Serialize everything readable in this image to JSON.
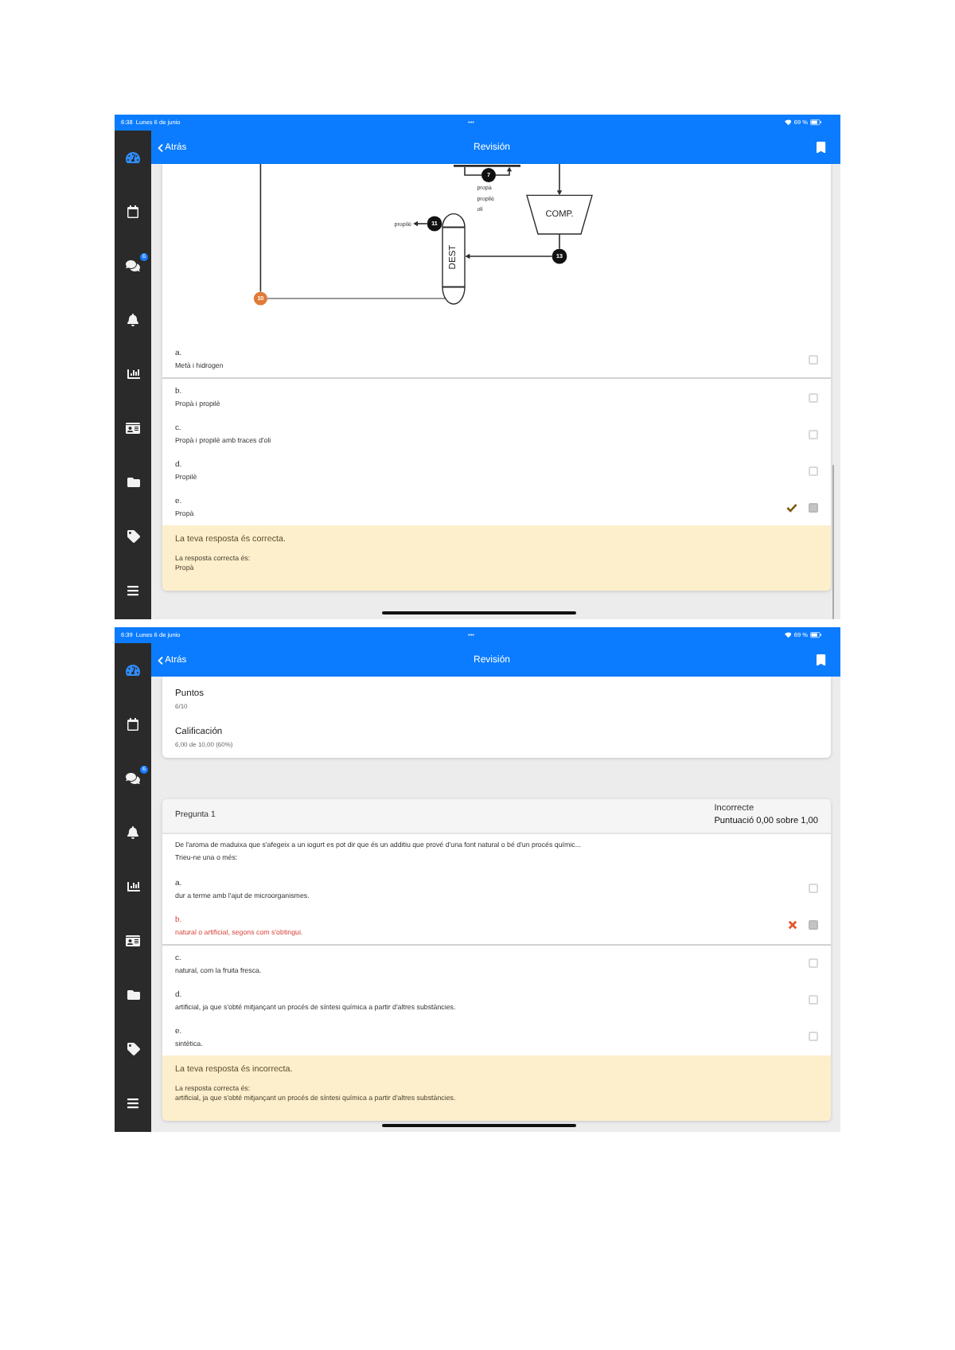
{
  "screens": [
    {
      "status_bar": {
        "time": "6:38",
        "date": "Lunes 6 de junio",
        "dots": "•••",
        "battery": "69 %"
      },
      "nav": {
        "back": "Atrás",
        "title": "Revisión"
      },
      "sidebar": [
        {
          "kind": "dashboard",
          "selected": true
        },
        {
          "kind": "calendar",
          "selected": false
        },
        {
          "kind": "messages",
          "selected": false,
          "badge": "6"
        },
        {
          "kind": "notifications",
          "selected": false
        },
        {
          "kind": "grades",
          "selected": false
        },
        {
          "kind": "badges",
          "selected": false
        },
        {
          "kind": "files",
          "selected": false
        },
        {
          "kind": "tags",
          "selected": false
        },
        {
          "kind": "menu",
          "selected": false
        }
      ],
      "cards": [
        {
          "kind": "question",
          "diagram": {
            "units": [
              {
                "kind": "compressor",
                "label": "COMP."
              },
              {
                "kind": "column",
                "label": "DEST"
              }
            ],
            "streams": [
              {
                "number": "7",
                "color": "#111111",
                "labels": [
                  "propà",
                  "propilè",
                  "oli"
                ]
              },
              {
                "number": "11",
                "color": "#111111",
                "labels": [
                  "propilè"
                ]
              },
              {
                "number": "13",
                "color": "#111111"
              },
              {
                "number": "10",
                "color": "#e07b39"
              }
            ]
          },
          "options": [
            {
              "kind": "plain",
              "letter": "a.",
              "text": "Metà i hidrogen",
              "checked": false,
              "divider": true
            },
            {
              "kind": "plain",
              "letter": "b.",
              "text": "Propà i propilè",
              "checked": false,
              "divider": false
            },
            {
              "kind": "plain",
              "letter": "c.",
              "text": "Propà i propilè amb traces d'oli",
              "checked": false,
              "divider": false
            },
            {
              "kind": "plain",
              "letter": "d.",
              "text": "Propilè",
              "checked": false,
              "divider": false
            },
            {
              "kind": "correct",
              "letter": "e.",
              "text": "Propà",
              "checked": true,
              "divider": false
            }
          ],
          "feedback": {
            "title": "La teva resposta és correcta.",
            "label": "La resposta correcta és:",
            "answer": "Propà"
          }
        }
      ]
    },
    {
      "status_bar": {
        "time": "6:39",
        "date": "Lunes 6 de junio",
        "dots": "•••",
        "battery": "69 %"
      },
      "nav": {
        "back": "Atrás",
        "title": "Revisión"
      },
      "sidebar": [
        {
          "kind": "dashboard",
          "selected": true
        },
        {
          "kind": "calendar",
          "selected": false
        },
        {
          "kind": "messages",
          "selected": false,
          "badge": "6"
        },
        {
          "kind": "notifications",
          "selected": false
        },
        {
          "kind": "grades",
          "selected": false
        },
        {
          "kind": "badges",
          "selected": false
        },
        {
          "kind": "files",
          "selected": false
        },
        {
          "kind": "tags",
          "selected": false
        },
        {
          "kind": "menu",
          "selected": false
        }
      ],
      "cards": [
        {
          "kind": "summary",
          "fields": [
            {
              "label": "Puntos",
              "value": "6/10"
            },
            {
              "label": "Calificación",
              "value": "6,00 de 10,00 (60%)"
            }
          ]
        },
        {
          "kind": "question",
          "header": {
            "title": "Pregunta 1",
            "state": "Incorrecte",
            "score": "Puntuació 0,00 sobre 1,00"
          },
          "question": "De l'aroma de maduixa que s'afegeix a un iogurt es pot dir que és un additiu que prové d'una font natural o bé d'un procés químic...",
          "prompt": "Trieu-ne una o més:",
          "options": [
            {
              "kind": "plain",
              "letter": "a.",
              "text": "dur a terme amb l'ajut de microorganismes.",
              "checked": false,
              "divider": false
            },
            {
              "kind": "incorrect",
              "letter": "b.",
              "text": "natural o artificial, segons com s'obtingui.",
              "checked": true,
              "divider": true
            },
            {
              "kind": "plain",
              "letter": "c.",
              "text": "natural, com la fruita fresca.",
              "checked": false,
              "divider": false
            },
            {
              "kind": "plain",
              "letter": "d.",
              "text": "artificial, ja que s'obté mitjançant un procés de síntesi química a partir d'altres substàncies.",
              "checked": false,
              "divider": false
            },
            {
              "kind": "plain",
              "letter": "e.",
              "text": "sintètica.",
              "checked": false,
              "divider": false
            }
          ],
          "feedback": {
            "title": "La teva resposta és incorrecta.",
            "label": "La resposta correcta és:",
            "answer": "artificial, ja que s'obté mitjançant un procés de síntesi química a partir d'altres substàncies."
          }
        }
      ]
    }
  ]
}
